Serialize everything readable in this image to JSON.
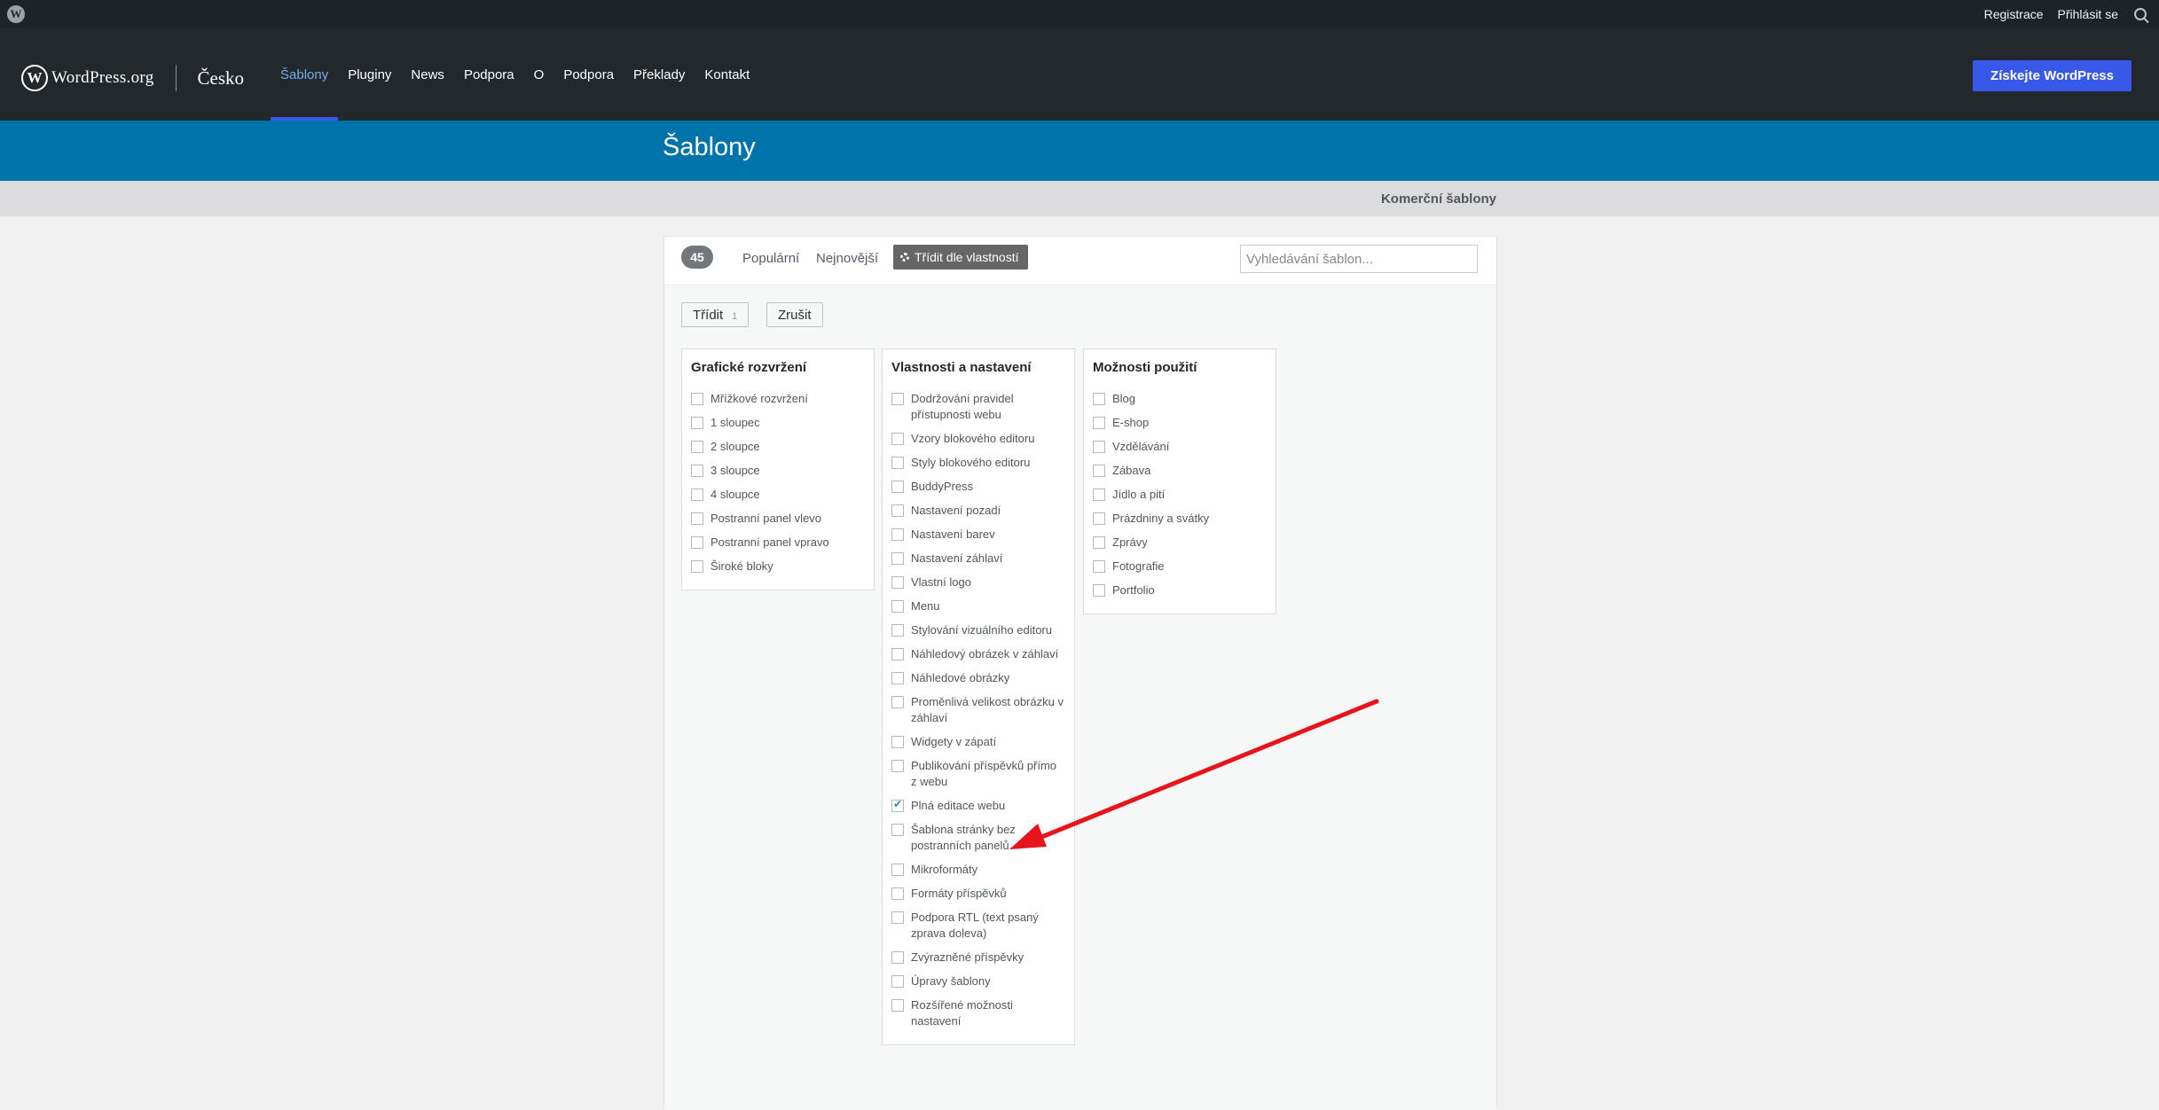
{
  "adminbar": {
    "links": [
      "Registrace",
      "Přihlásit se"
    ]
  },
  "header": {
    "logo_wordmark": "WordPress.org",
    "logo_mark": "W",
    "locale": "Česko",
    "nav": [
      "Šablony",
      "Pluginy",
      "News",
      "Podpora",
      "O",
      "Podpora",
      "Překlady",
      "Kontakt"
    ],
    "active_nav": "Šablony",
    "cta": "Získejte WordPress"
  },
  "band": {
    "title": "Šablony"
  },
  "subnav": {
    "link": "Komerční šablony"
  },
  "filterbar": {
    "count": "45",
    "popular": "Populární",
    "latest": "Nejnovější",
    "feature_filter": "Třídit dle vlastností",
    "search_placeholder": "Vyhledávání šablon..."
  },
  "drawer": {
    "apply_label": "Třídit",
    "apply_count": "1",
    "clear_label": "Zrušit",
    "groups": [
      {
        "title": "Grafické rozvržení",
        "options": [
          {
            "label": "Mřížkové rozvržení",
            "checked": false
          },
          {
            "label": "1 sloupec",
            "checked": false
          },
          {
            "label": "2 sloupce",
            "checked": false
          },
          {
            "label": "3 sloupce",
            "checked": false
          },
          {
            "label": "4 sloupce",
            "checked": false
          },
          {
            "label": "Postranní panel vlevo",
            "checked": false
          },
          {
            "label": "Postranní panel vpravo",
            "checked": false
          },
          {
            "label": "Široké bloky",
            "checked": false
          }
        ]
      },
      {
        "title": "Vlastnosti a nastavení",
        "options": [
          {
            "label": "Dodržování pravidel přístupnosti webu",
            "checked": false
          },
          {
            "label": "Vzory blokového editoru",
            "checked": false
          },
          {
            "label": "Styly blokového editoru",
            "checked": false
          },
          {
            "label": "BuddyPress",
            "checked": false
          },
          {
            "label": "Nastavení pozadí",
            "checked": false
          },
          {
            "label": "Nastavení barev",
            "checked": false
          },
          {
            "label": "Nastavení záhlaví",
            "checked": false
          },
          {
            "label": "Vlastní logo",
            "checked": false
          },
          {
            "label": "Menu",
            "checked": false
          },
          {
            "label": "Stylování vizuálního editoru",
            "checked": false
          },
          {
            "label": "Náhledový obrázek v záhlaví",
            "checked": false
          },
          {
            "label": "Náhledové obrázky",
            "checked": false
          },
          {
            "label": "Proměnlivá velikost obrázku v záhlaví",
            "checked": false
          },
          {
            "label": "Widgety v zápatí",
            "checked": false
          },
          {
            "label": "Publikování příspěvků přímo z webu",
            "checked": false
          },
          {
            "label": "Plná editace webu",
            "checked": true
          },
          {
            "label": "Šablona stránky bez postranních panelů",
            "checked": false
          },
          {
            "label": "Mikroformáty",
            "checked": false
          },
          {
            "label": "Formáty příspěvků",
            "checked": false
          },
          {
            "label": "Podpora RTL (text psaný zprava doleva)",
            "checked": false
          },
          {
            "label": "Zvýrazněné příspěvky",
            "checked": false
          },
          {
            "label": "Úpravy šablony",
            "checked": false
          },
          {
            "label": "Rozšířené možnosti nastavení",
            "checked": false
          }
        ]
      },
      {
        "title": "Možnosti použití",
        "options": [
          {
            "label": "Blog",
            "checked": false
          },
          {
            "label": "E-shop",
            "checked": false
          },
          {
            "label": "Vzdělávání",
            "checked": false
          },
          {
            "label": "Zábava",
            "checked": false
          },
          {
            "label": "Jídlo a pití",
            "checked": false
          },
          {
            "label": "Prázdniny a svátky",
            "checked": false
          },
          {
            "label": "Zprávy",
            "checked": false
          },
          {
            "label": "Fotografie",
            "checked": false
          },
          {
            "label": "Portfolio",
            "checked": false
          }
        ]
      }
    ]
  },
  "annotation": {
    "arrow_color": "#e8141b"
  }
}
